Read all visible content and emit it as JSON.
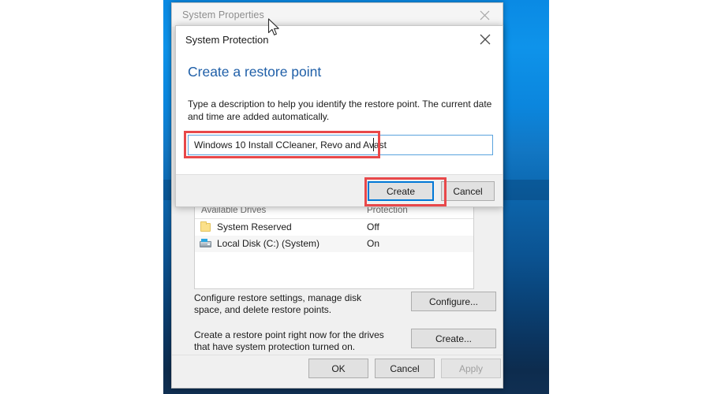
{
  "parent_window": {
    "title": "System Properties",
    "close_icon": "close-icon",
    "drive_list": {
      "headers": [
        "Available Drives",
        "Protection"
      ],
      "rows": [
        {
          "icon": "folder-icon",
          "name": "System Reserved",
          "protection": "Off"
        },
        {
          "icon": "drive-icon",
          "name": "Local Disk (C:) (System)",
          "protection": "On"
        }
      ]
    },
    "configure_section": {
      "text": "Configure restore settings, manage disk space, and delete restore points.",
      "button": "Configure..."
    },
    "create_section": {
      "text": "Create a restore point right now for the drives that have system protection turned on.",
      "button": "Create..."
    },
    "footer": {
      "ok": "OK",
      "cancel": "Cancel",
      "apply": "Apply"
    }
  },
  "child_dialog": {
    "title": "System Protection",
    "close_icon": "close-icon",
    "heading": "Create a restore point",
    "description": "Type a description to help you identify the restore point. The current date and time are added automatically.",
    "input": {
      "value": "Windows 10 Install CCleaner, Revo and Avast",
      "placeholder": ""
    },
    "buttons": {
      "create": "Create",
      "cancel": "Cancel"
    }
  },
  "annotations": {
    "color": "#e8484a",
    "boxes": [
      "description-input",
      "create-button"
    ]
  },
  "colors": {
    "accent_blue": "#0078d7",
    "heading_blue": "#1f5fa8",
    "annotation_red": "#e8484a",
    "desktop_blue": "#0a8ae4",
    "dialog_gray": "#f0f0f0"
  }
}
